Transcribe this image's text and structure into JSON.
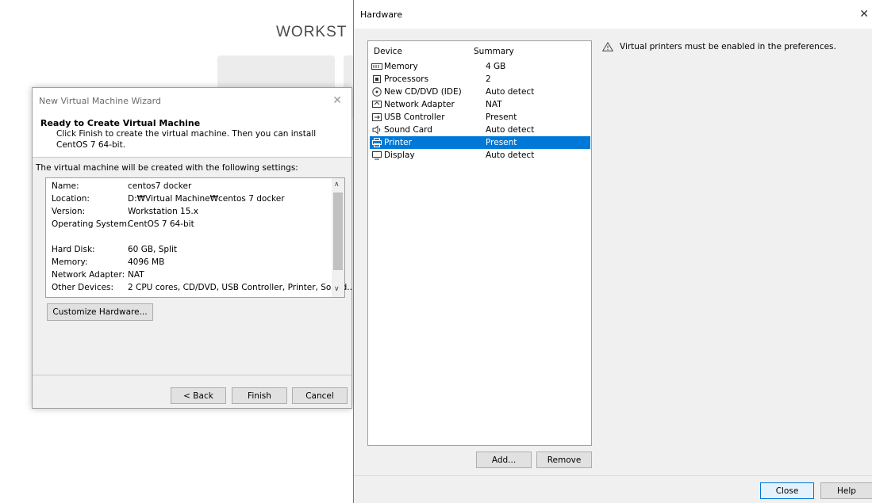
{
  "background": {
    "title": "WORKST"
  },
  "wizard": {
    "title": "New Virtual Machine Wizard",
    "header_title": "Ready to Create Virtual Machine",
    "header_desc": "Click Finish to create the virtual machine. Then you can install CentOS 7 64-bit.",
    "intro": "The virtual machine will be created with the following settings:",
    "settings": [
      {
        "key": "Name:",
        "value": "centos7 docker"
      },
      {
        "key": "Location:",
        "value": "D:₩Virtual Machine₩centos 7 docker"
      },
      {
        "key": "Version:",
        "value": "Workstation 15.x"
      },
      {
        "key": "Operating System:",
        "value": "CentOS 7 64-bit"
      },
      {
        "key": "Hard Disk:",
        "value": "60 GB, Split"
      },
      {
        "key": "Memory:",
        "value": "4096 MB"
      },
      {
        "key": "Network Adapter:",
        "value": "NAT"
      },
      {
        "key": "Other Devices:",
        "value": "2 CPU cores, CD/DVD, USB Controller, Printer, Sound..."
      }
    ],
    "customize_label": "Customize Hardware...",
    "back_label": "< Back",
    "finish_label": "Finish",
    "cancel_label": "Cancel"
  },
  "hardware": {
    "title": "Hardware",
    "col_device": "Device",
    "col_summary": "Summary",
    "devices": [
      {
        "name": "Memory",
        "summary": "4 GB",
        "icon": "memory-icon"
      },
      {
        "name": "Processors",
        "summary": "2",
        "icon": "processor-icon"
      },
      {
        "name": "New CD/DVD (IDE)",
        "summary": "Auto detect",
        "icon": "cd-dvd-icon"
      },
      {
        "name": "Network Adapter",
        "summary": "NAT",
        "icon": "network-adapter-icon"
      },
      {
        "name": "USB Controller",
        "summary": "Present",
        "icon": "usb-icon"
      },
      {
        "name": "Sound Card",
        "summary": "Auto detect",
        "icon": "speaker-icon"
      },
      {
        "name": "Printer",
        "summary": "Present",
        "icon": "printer-icon"
      },
      {
        "name": "Display",
        "summary": "Auto detect",
        "icon": "display-icon"
      }
    ],
    "selected_device": "Printer",
    "warning": "Virtual printers must be enabled in the preferences.",
    "add_label": "Add...",
    "remove_label": "Remove",
    "close_label": "Close",
    "help_label": "Help"
  },
  "colors": {
    "selection": "#0078d7",
    "dialog_bg": "#f0f0f0"
  }
}
